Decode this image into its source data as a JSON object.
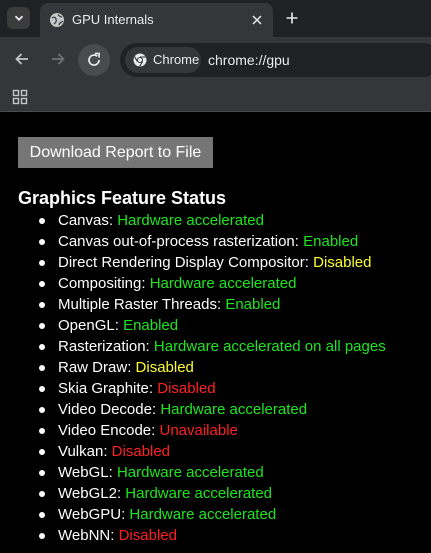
{
  "tab": {
    "title": "GPU Internals"
  },
  "omnibox": {
    "chip_label": "Chrome",
    "url": "chrome://gpu"
  },
  "page": {
    "download_button": "Download Report to File",
    "section_title": "Graphics Feature Status",
    "colors": {
      "green": "#1ee61e",
      "yellow": "#ffff33",
      "red": "#ff2020"
    },
    "features": [
      {
        "name": "Canvas",
        "status": "Hardware accelerated",
        "color": "#1ee61e"
      },
      {
        "name": "Canvas out-of-process rasterization",
        "status": "Enabled",
        "color": "#1ee61e"
      },
      {
        "name": "Direct Rendering Display Compositor",
        "status": "Disabled",
        "color": "#ffff33"
      },
      {
        "name": "Compositing",
        "status": "Hardware accelerated",
        "color": "#1ee61e"
      },
      {
        "name": "Multiple Raster Threads",
        "status": "Enabled",
        "color": "#1ee61e"
      },
      {
        "name": "OpenGL",
        "status": "Enabled",
        "color": "#1ee61e"
      },
      {
        "name": "Rasterization",
        "status": "Hardware accelerated on all pages",
        "color": "#1ee61e"
      },
      {
        "name": "Raw Draw",
        "status": "Disabled",
        "color": "#ffff33"
      },
      {
        "name": "Skia Graphite",
        "status": "Disabled",
        "color": "#ff2020"
      },
      {
        "name": "Video Decode",
        "status": "Hardware accelerated",
        "color": "#1ee61e"
      },
      {
        "name": "Video Encode",
        "status": "Unavailable",
        "color": "#ff2020"
      },
      {
        "name": "Vulkan",
        "status": "Disabled",
        "color": "#ff2020"
      },
      {
        "name": "WebGL",
        "status": "Hardware accelerated",
        "color": "#1ee61e"
      },
      {
        "name": "WebGL2",
        "status": "Hardware accelerated",
        "color": "#1ee61e"
      },
      {
        "name": "WebGPU",
        "status": "Hardware accelerated",
        "color": "#1ee61e"
      },
      {
        "name": "WebNN",
        "status": "Disabled",
        "color": "#ff2020"
      }
    ]
  }
}
